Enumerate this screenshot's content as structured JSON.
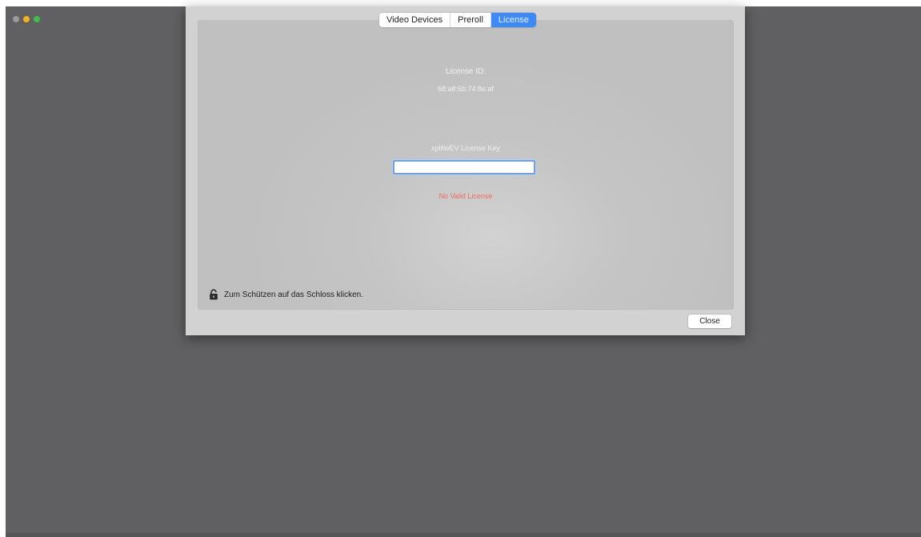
{
  "tabs": [
    {
      "label": "Video Devices",
      "active": false
    },
    {
      "label": "Preroll",
      "active": true
    },
    {
      "label": "License",
      "active": true
    }
  ],
  "license": {
    "id_label": "License ID:",
    "id_value": "68:a8:6b:74:8e:af",
    "key_label": "xplitwEV License Key",
    "key_value": "",
    "status": "No Valid License"
  },
  "lock": {
    "text": "Zum Schützen auf das Schloss klicken."
  },
  "buttons": {
    "close_label": "Close"
  },
  "colors": {
    "desktop": "#606062",
    "sheet": "#d2d2d2",
    "accent": "#3d8af7",
    "error": "#f26a5a"
  }
}
